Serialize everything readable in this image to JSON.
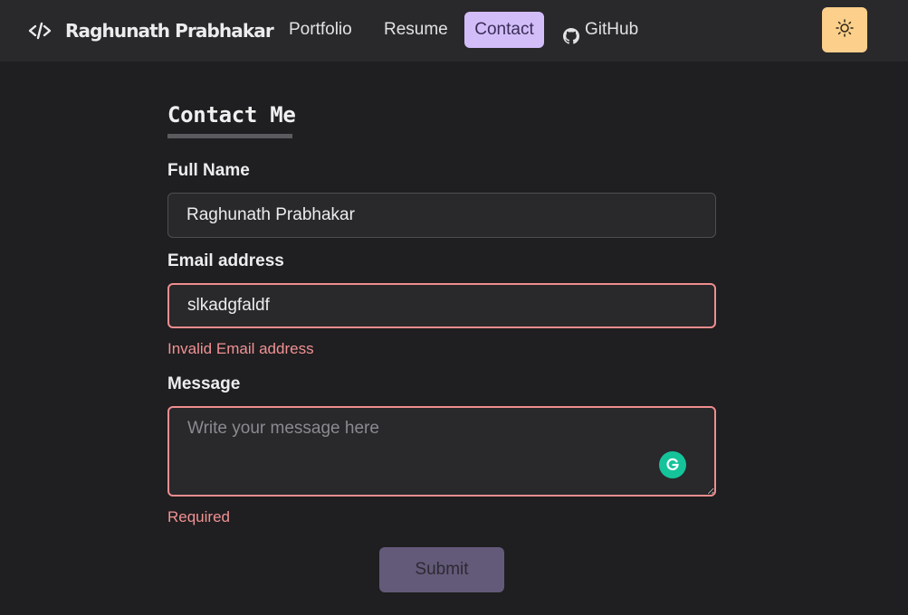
{
  "navbar": {
    "brand_icon": "code-brackets-icon",
    "brand_name": "Raghunath Prabhakar",
    "links": [
      {
        "label": "Portfolio"
      },
      {
        "label": "Resume"
      },
      {
        "label": "Contact",
        "active": true
      },
      {
        "label": "GitHub",
        "icon": "github-icon"
      }
    ],
    "theme_toggle_icon": "sun-icon"
  },
  "form": {
    "title": "Contact Me",
    "full_name": {
      "label": "Full Name",
      "value": "Raghunath Prabhakar"
    },
    "email": {
      "label": "Email address",
      "value": "slkadgfaldf",
      "error": "Invalid Email address"
    },
    "message": {
      "label": "Message",
      "value": "",
      "placeholder": "Write your message here",
      "error": "Required"
    },
    "submit_label": "Submit"
  },
  "colors": {
    "background": "#1f1e20",
    "navbar": "#29282b",
    "active_link_bg": "#d3bdf9",
    "theme_toggle_bg": "#fccf8a",
    "error": "#f09294",
    "submit_bg": "#635a79",
    "grammarly": "#15c39a"
  }
}
